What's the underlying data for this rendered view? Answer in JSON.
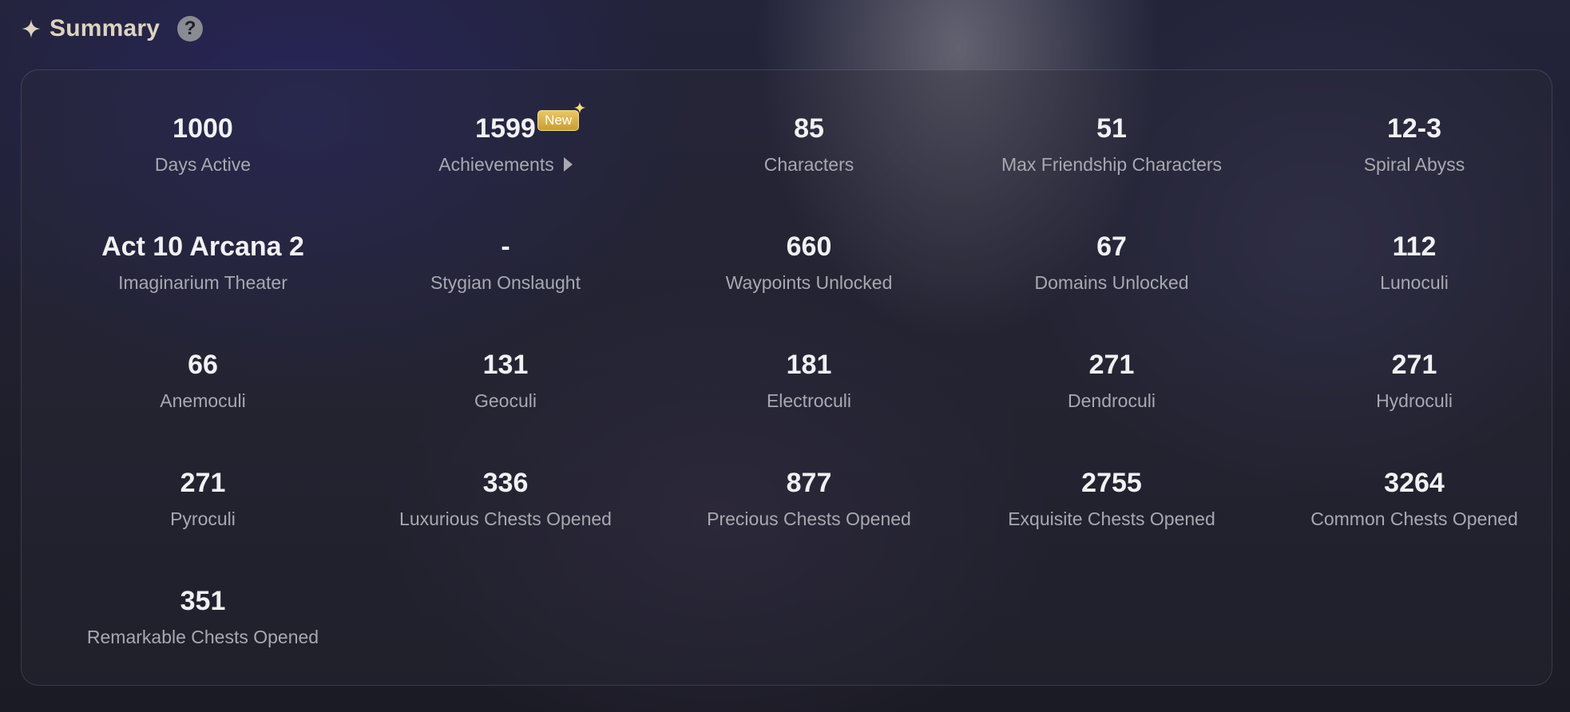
{
  "header": {
    "title": "Summary",
    "help_symbol": "?",
    "icons": [
      "sparkle-star-icon",
      "help-circle-icon"
    ],
    "title_color": "#ddd3c0"
  },
  "summary": {
    "badge_label": "New",
    "badge_color": "#d6ac42",
    "stats": [
      {
        "value": "1000",
        "label": "Days Active"
      },
      {
        "value": "1599",
        "label": "Achievements",
        "badge": true,
        "link": true
      },
      {
        "value": "85",
        "label": "Characters"
      },
      {
        "value": "51",
        "label": "Max Friendship Characters"
      },
      {
        "value": "12-3",
        "label": "Spiral Abyss"
      },
      {
        "value": "Act 10 Arcana 2",
        "label": "Imaginarium Theater"
      },
      {
        "value": "-",
        "label": "Stygian Onslaught"
      },
      {
        "value": "660",
        "label": "Waypoints Unlocked"
      },
      {
        "value": "67",
        "label": "Domains Unlocked"
      },
      {
        "value": "112",
        "label": "Lunoculi"
      },
      {
        "value": "66",
        "label": "Anemoculi"
      },
      {
        "value": "131",
        "label": "Geoculi"
      },
      {
        "value": "181",
        "label": "Electroculi"
      },
      {
        "value": "271",
        "label": "Dendroculi"
      },
      {
        "value": "271",
        "label": "Hydroculi"
      },
      {
        "value": "271",
        "label": "Pyroculi"
      },
      {
        "value": "336",
        "label": "Luxurious Chests Opened"
      },
      {
        "value": "877",
        "label": "Precious Chests Opened"
      },
      {
        "value": "2755",
        "label": "Exquisite Chests Opened"
      },
      {
        "value": "3264",
        "label": "Common Chests Opened"
      },
      {
        "value": "351",
        "label": "Remarkable Chests Opened"
      }
    ]
  }
}
